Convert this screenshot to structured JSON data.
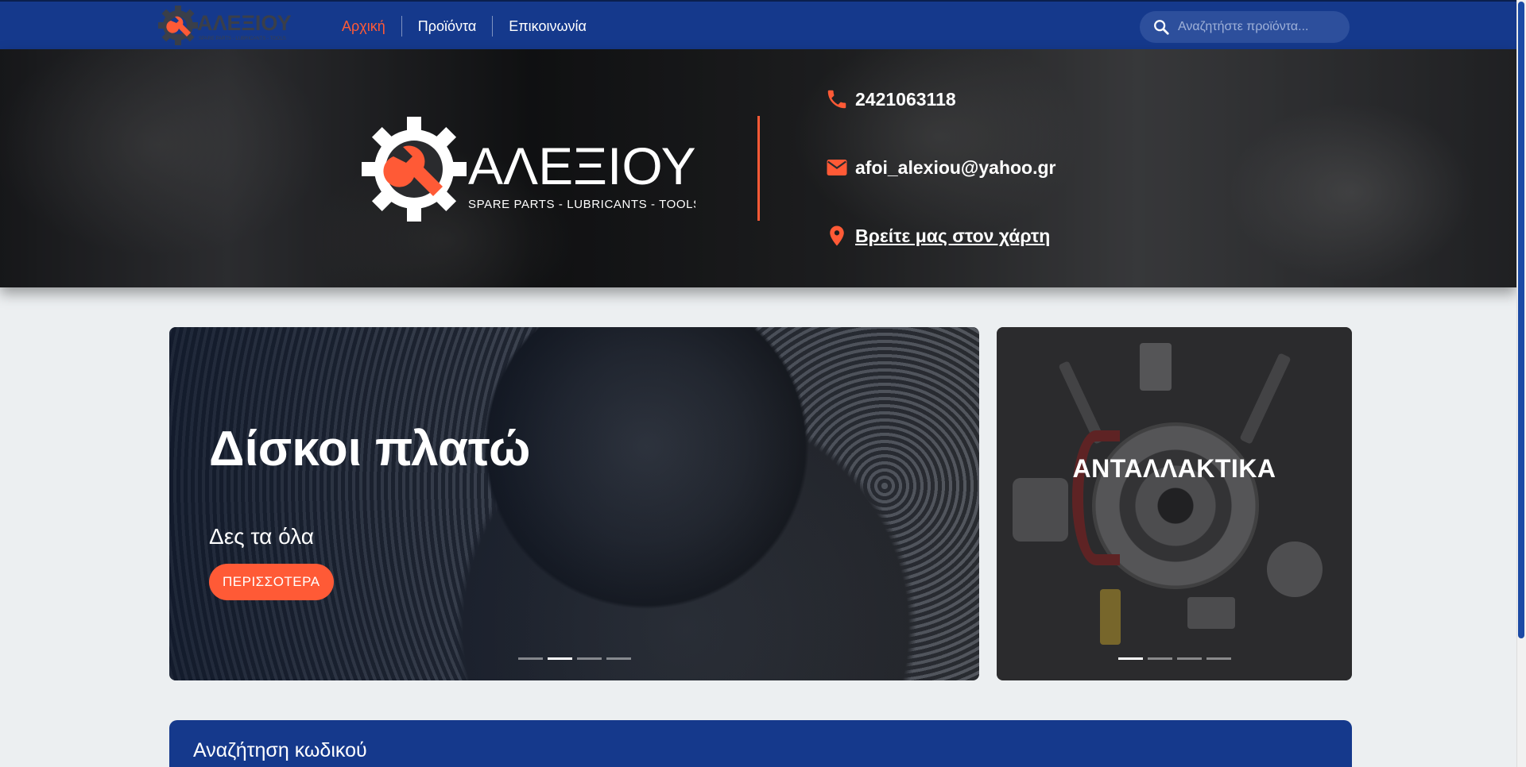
{
  "navbar": {
    "logo_text": "ΑΛΕΞΙΟΥ",
    "logo_tagline": "SPARE PARTS - LUBRICANTS - TOOLS",
    "links": [
      {
        "label": "Αρχική",
        "active": true
      },
      {
        "label": "Προϊόντα",
        "active": false
      },
      {
        "label": "Επικοινωνία",
        "active": false
      }
    ],
    "search_placeholder": "Αναζητήστε προϊόντα...",
    "search_icon": "search-icon"
  },
  "hero": {
    "logo_text": "ΑΛΕΞΙΟΥ",
    "logo_tagline": "SPARE PARTS - LUBRICANTS - TOOLS",
    "phone": "2421063118",
    "email": "afoi_alexiou@yahoo.gr",
    "map_link": "Βρείτε μας στον χάρτη"
  },
  "carousel_main": {
    "title": "Δίσκοι πλατώ",
    "subtitle": "Δες τα όλα",
    "button": "ΠΕΡΙΣΣΟΤΕΡΑ",
    "slide_count": 4,
    "active_index": 1
  },
  "carousel_side": {
    "title": "ΑΝΤΑΛΛΑΚΤΙΚΑ",
    "slide_count": 4,
    "active_index": 0
  },
  "code_search": {
    "title": "Αναζήτηση κωδικού"
  },
  "colors": {
    "primary": "#15398c",
    "accent": "#ff5a36",
    "background": "#eceff1"
  }
}
